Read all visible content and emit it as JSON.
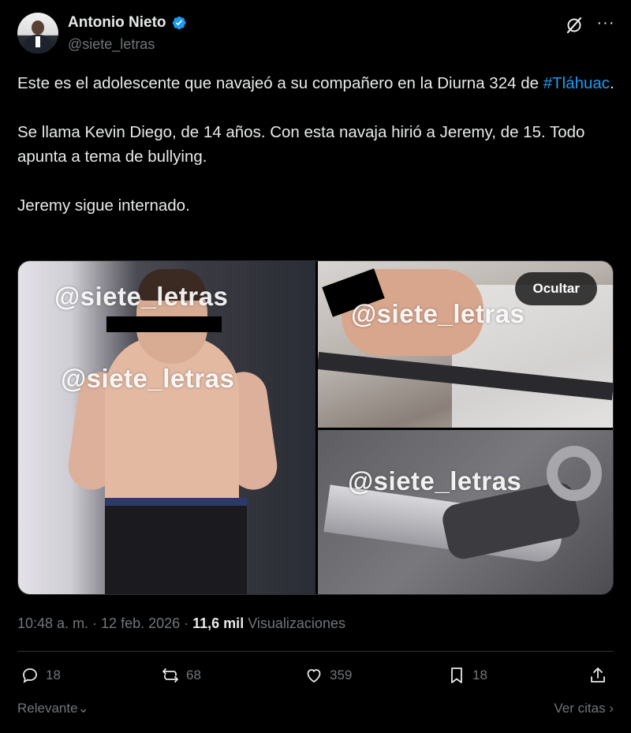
{
  "author": {
    "name": "Antonio Nieto",
    "handle": "@siete_letras",
    "verified": true,
    "verified_color": "#1d9bf0"
  },
  "tweet": {
    "line1_before": "Este es el adolescente que navajeó a su compañero en la Diurna 324 de",
    "hashtag": "#Tláhuac",
    "line1_after": ".",
    "para2": "Se llama Kevin Diego, de 14 años. Con esta navaja hirió a Jeremy, de 15. Todo apunta a tema de bullying.",
    "para3": "Jeremy sigue internado."
  },
  "media": {
    "watermark": "@siete_letras",
    "hide_label": "Ocultar"
  },
  "meta": {
    "time": "10:48 a. m. · 12 feb. 2026 · ",
    "views_count": "11,6 mil",
    "views_label": "Visualizaciones"
  },
  "actions": {
    "replies": "18",
    "reposts": "68",
    "likes": "359",
    "bookmarks": "18"
  },
  "footer": {
    "sort_label": "Relevante",
    "quotes_label": "Ver citas"
  },
  "colors": {
    "background": "#000000",
    "text": "#e7e9ea",
    "muted": "#71767b",
    "link": "#1d9bf0",
    "divider": "#2f3336"
  }
}
